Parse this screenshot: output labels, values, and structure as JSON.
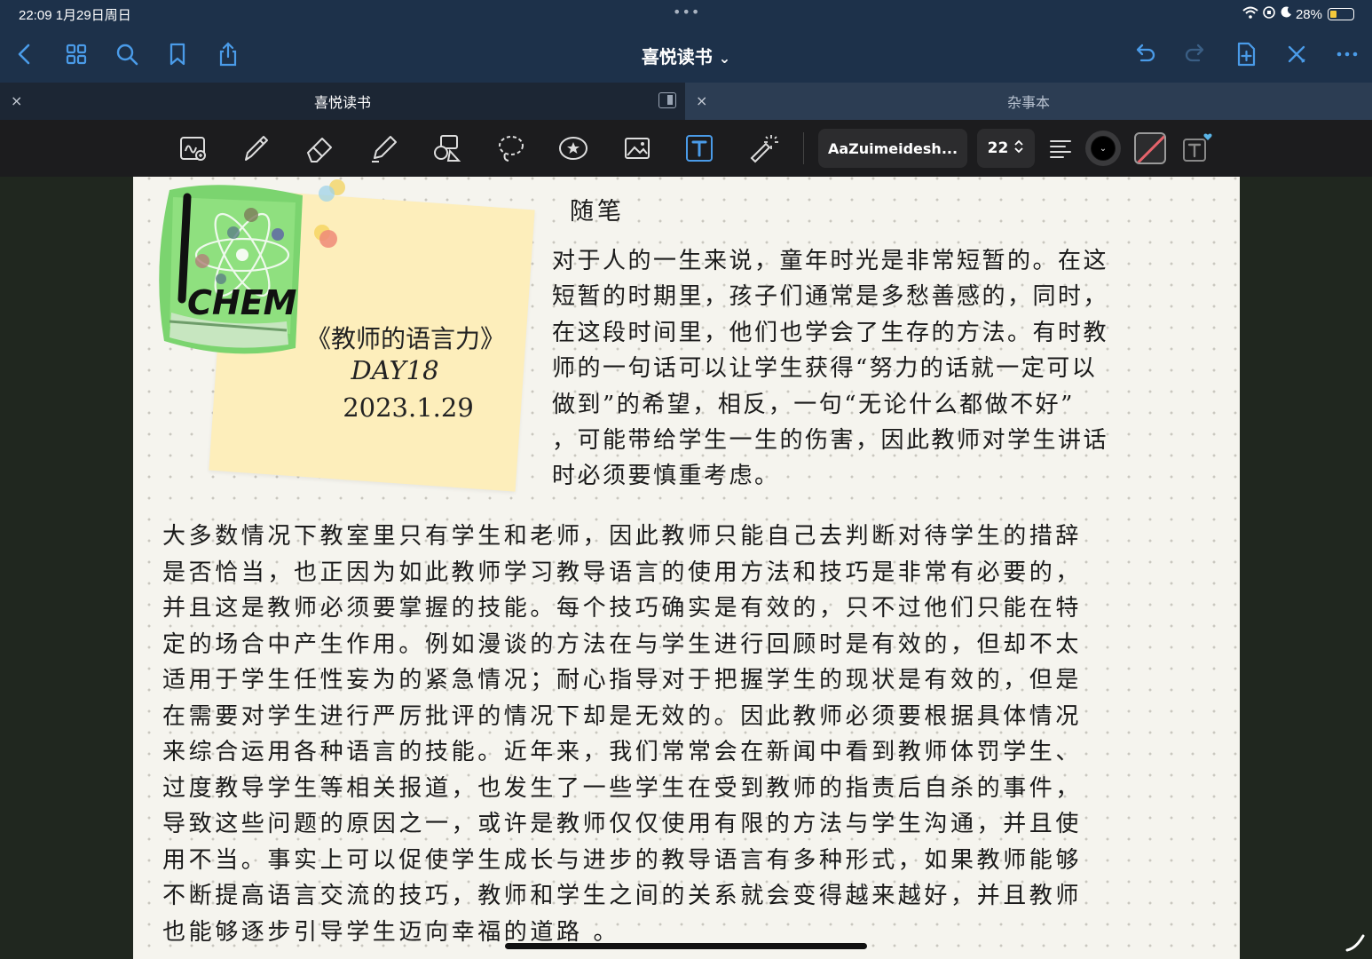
{
  "status_bar": {
    "time_date": "22:09  1月29日周日",
    "battery_percent": "28%",
    "more_dots": "•••"
  },
  "nav": {
    "title": "喜悦读书",
    "title_chevron": "⌄",
    "icons": [
      "back-icon",
      "grid-icon",
      "search-icon",
      "bookmark-icon",
      "share-icon",
      "undo-icon",
      "redo-icon",
      "add-page-icon",
      "close-editing-icon",
      "more-icon"
    ]
  },
  "tabs": [
    {
      "label": "喜悦读书",
      "close": "×",
      "active": true
    },
    {
      "label": "杂事本",
      "close": "×",
      "active": false
    }
  ],
  "toolbar": {
    "active_tool": "text-tool",
    "font_name": "AaZuimeidesh...",
    "font_size": "22",
    "text_color": "#000000",
    "accent": "#4a9be8"
  },
  "note": {
    "book_label": "CHEM",
    "book_tag": "I",
    "line1": "《教师的语言力》",
    "line2": "DAY18",
    "line3": "2023.1.29"
  },
  "essay": {
    "title": "随笔",
    "para1": [
      " 对于人的一生来说，童年时光是非常短暂的。在这",
      "短暂的时期里，孩子们通常是多愁善感的，同时，",
      "在这段时间里，他们也学会了生存的方法。有时教",
      "师的一句话可以让学生获得“努力的话就一定可以",
      "做到”的希望，相反，一句“无论什么都做不好”",
      "，可能带给学生一生的伤害，因此教师对学生讲话",
      "时必须要慎重考虑。"
    ],
    "para2": [
      " 大多数情况下教室里只有学生和老师，因此教师只能自己去判断对待学生的措辞",
      "是否恰当，也正因为如此教师学习教导语言的使用方法和技巧是非常有必要的，",
      "并且这是教师必须要掌握的技能。每个技巧确实是有效的，只不过他们只能在特",
      "定的场合中产生作用。例如漫谈的方法在与学生进行回顾时是有效的，但却不太",
      "适用于学生任性妄为的紧急情况；耐心指导对于把握学生的现状是有效的，但是",
      "在需要对学生进行严厉批评的情况下却是无效的。因此教师必须要根据具体情况",
      "来综合运用各种语言的技能。近年来，我们常常会在新闻中看到教师体罚学生、",
      "过度教导学生等相关报道，也发生了一些学生在受到教师的指责后自杀的事件，",
      "导致这些问题的原因之一，或许是教师仅仅使用有限的方法与学生沟通，并且使",
      "用不当。事实上可以促使学生成长与进步的教导语言有多种形式，如果教师能够",
      "不断提高语言交流的技巧，教师和学生之间的关系就会变得越来越好，并且教师",
      "也能够逐步引导学生迈向幸福的道路 。"
    ]
  }
}
